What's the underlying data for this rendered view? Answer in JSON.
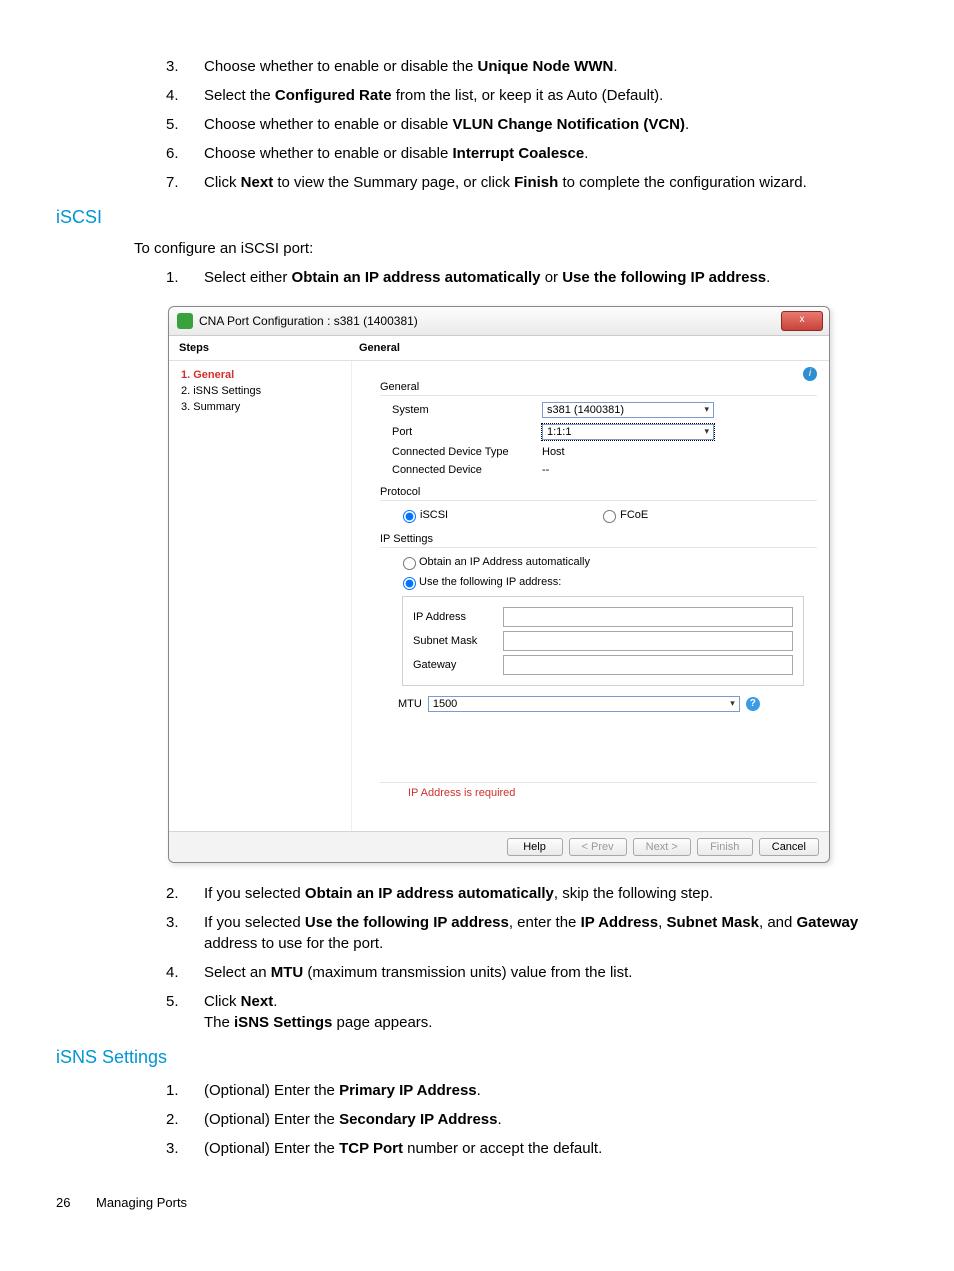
{
  "top_steps": [
    {
      "n": "3.",
      "text_pre": "Choose whether to enable or disable the ",
      "bold": "Unique Node WWN",
      "text_post": "."
    },
    {
      "n": "4.",
      "text_pre": "Select the ",
      "bold": "Configured Rate",
      "text_post": " from the list, or keep it as Auto (Default)."
    },
    {
      "n": "5.",
      "text_pre": "Choose whether to enable or disable ",
      "bold": "VLUN Change Notification (VCN)",
      "text_post": "."
    },
    {
      "n": "6.",
      "text_pre": "Choose whether to enable or disable ",
      "bold": "Interrupt Coalesce",
      "text_post": "."
    },
    {
      "n": "7.",
      "pre": "Click ",
      "b1": "Next",
      "mid": " to view the Summary page, or click ",
      "b2": "Finish",
      "post": " to complete the configuration wizard."
    }
  ],
  "heading_iscsi": "iSCSI",
  "iscsi_intro": "To configure an iSCSI port:",
  "iscsi_step1": {
    "n": "1.",
    "pre": "Select either ",
    "b1": "Obtain an IP address automatically",
    "mid": " or ",
    "b2": "Use the following IP address",
    "post": "."
  },
  "dialog": {
    "title": "CNA Port Configuration : s381 (1400381)",
    "close_x": "x",
    "header_steps": "Steps",
    "header_general": "General",
    "steps": [
      {
        "label": "1. General",
        "current": true
      },
      {
        "label": "2. iSNS Settings",
        "current": false
      },
      {
        "label": "3. Summary",
        "current": false
      }
    ],
    "group_general_title": "General",
    "labels": {
      "system": "System",
      "port": "Port",
      "cdt": "Connected Device Type",
      "cd": "Connected Device"
    },
    "values": {
      "system": "s381 (1400381)",
      "port": "1:1:1",
      "cdt": "Host",
      "cd": "--"
    },
    "group_protocol_title": "Protocol",
    "protocol": {
      "iscsi": "iSCSI",
      "fcoe": "FCoE"
    },
    "group_ip_title": "IP Settings",
    "ip_auto": "Obtain an IP Address automatically",
    "ip_manual": "Use the following IP address:",
    "ip_fields": {
      "ip": "IP Address",
      "mask": "Subnet Mask",
      "gw": "Gateway"
    },
    "mtu_label": "MTU",
    "mtu_value": "1500",
    "error": "IP Address is required",
    "buttons": {
      "help": "Help",
      "prev": "< Prev",
      "next": "Next >",
      "finish": "Finish",
      "cancel": "Cancel"
    }
  },
  "after_steps": [
    {
      "n": "2.",
      "pre": "If you selected ",
      "b1": "Obtain an IP address automatically",
      "post": ", skip the following step."
    },
    {
      "n": "3.",
      "pre": "If you selected ",
      "b1": "Use the following IP address",
      "mid": ", enter the ",
      "b2": "IP Address",
      "mid2": ", ",
      "b3": "Subnet Mask",
      "mid3": ", and ",
      "b4": "Gateway",
      "post": " address to use for the port."
    },
    {
      "n": "4.",
      "pre": "Select an ",
      "b1": "MTU",
      "post": " (maximum transmission units) value from the list."
    },
    {
      "n": "5.",
      "pre": "Click ",
      "b1": "Next",
      "post": ".",
      "extra_pre": "The ",
      "extra_b": "iSNS Settings",
      "extra_post": " page appears."
    }
  ],
  "heading_isns": "iSNS Settings",
  "isns_steps": [
    {
      "n": "1.",
      "pre": "(Optional) Enter the ",
      "b1": "Primary IP Address",
      "post": "."
    },
    {
      "n": "2.",
      "pre": "(Optional) Enter the ",
      "b1": "Secondary IP Address",
      "post": "."
    },
    {
      "n": "3.",
      "pre": "(Optional) Enter the ",
      "b1": "TCP Port",
      "post": " number or accept the default."
    }
  ],
  "footer": {
    "page": "26",
    "section": "Managing Ports"
  }
}
